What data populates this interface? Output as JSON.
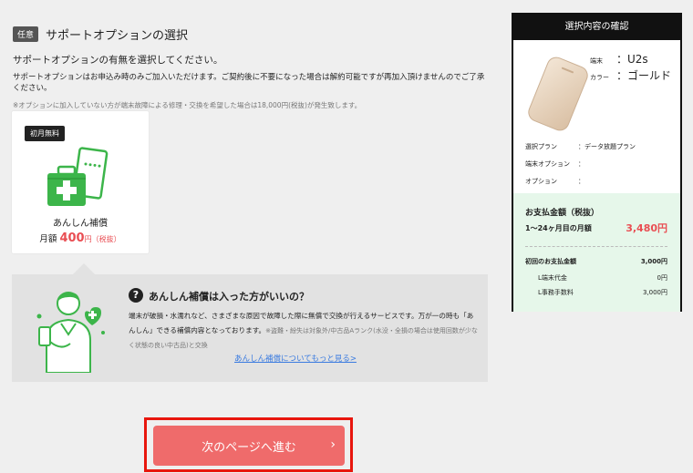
{
  "section": {
    "tag": "任意",
    "title": "サポートオプションの選択"
  },
  "intro": {
    "main": "サポートオプションの有無を選択してください。",
    "sub": "サポートオプションはお申込み時のみご加入いただけます。ご契約後に不要になった場合は解約可能ですが再加入頂けませんのでご了承ください。",
    "note": "※オプションに加入していない方が端末故障による修理・交換を希望した場合は18,000円(税抜)が発生致します。"
  },
  "option_card": {
    "badge": "初月無料",
    "name": "あんしん補償",
    "price_prefix": "月額",
    "price": "400",
    "price_unit": "円",
    "price_tax": "（税抜）"
  },
  "info": {
    "q_icon": "?",
    "title": "あんしん補償は入った方がいいの？",
    "body_main": "端末が破損・水濡れなど、さまざまな原因で故障した際に無償で交換が行えるサービスです。万が一の時も「あんしん」できる補償内容となっております。",
    "body_small": "※盗難・紛失は対象外/中古品Aランク(水没・全損の場合は使用回数が少なく状態の良い中古品)と交換",
    "link": "あんしん補償についてもっと見る>"
  },
  "next_button": {
    "label": "次のページへ進む",
    "chevron": "›"
  },
  "summary": {
    "title": "選択内容の確認",
    "device_label_1": "端末",
    "device_label_2": "カラー",
    "device_value_1": "：U2s",
    "device_value_2": "：ゴールド",
    "specs": [
      {
        "label": "選択プラン",
        "value": "：データ放題プラン"
      },
      {
        "label": "端末オプション",
        "value": "："
      },
      {
        "label": "オプション",
        "value": "："
      }
    ],
    "pay_title": "お支払金額（税抜）",
    "pay_month_label": "1〜24ヶ月目の月額",
    "pay_month_amount": "3,480円",
    "first_label": "初回のお支払金額",
    "first_amount": "3,000円",
    "first_items": [
      {
        "label": "L端末代金",
        "value": "0円"
      },
      {
        "label": "L事務手数料",
        "value": "3,000円"
      }
    ]
  },
  "colors": {
    "accent": "#e94e53",
    "button": "#ef6b6b",
    "highlight_frame": "#e8160d",
    "icon_green": "#3cb54a"
  }
}
